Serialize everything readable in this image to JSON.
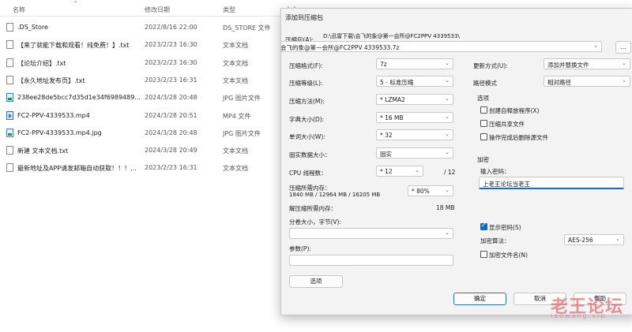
{
  "explorer": {
    "columns": {
      "name": "名称",
      "date": "修改日期",
      "type": "类型",
      "size": "大小"
    },
    "files": [
      {
        "name": ".DS_Store",
        "date": "2022/8/16 22:00",
        "type": "DS_STORE 文件",
        "icon": "file-icon"
      },
      {
        "name": "【来了就能下载和观看！纯免费！】.txt",
        "date": "2023/2/23 16:30",
        "type": "文本文档",
        "icon": "text-file-icon"
      },
      {
        "name": "【论坛介绍】.txt",
        "date": "2023/2/23 16:30",
        "type": "文本文档",
        "icon": "text-file-icon"
      },
      {
        "name": "【永久地址发布页】.txt",
        "date": "2023/2/23 16:31",
        "type": "文本文档",
        "icon": "text-file-icon"
      },
      {
        "name": "238ee28de5bcc7d35d1e34f6989489...",
        "date": "2024/3/28 20:48",
        "type": "JPG 图片文件",
        "icon": "image-file-icon"
      },
      {
        "name": "FC2-PPV-4339533.mp4",
        "date": "2024/3/28 20:51",
        "type": "MP4 文件",
        "icon": "video-file-icon"
      },
      {
        "name": "FC2-PPV-4339533.mp4.jpg",
        "date": "2024/3/28 20:48",
        "type": "JPG 图片文件",
        "icon": "image-file-icon"
      },
      {
        "name": "新建 文本文档.txt",
        "date": "2024/3/28 20:49",
        "type": "文本文档",
        "icon": "text-file-icon"
      },
      {
        "name": "最新地址及APP请发邮箱自动获取！！！...",
        "date": "2023/2/23 16:31",
        "type": "文本文档",
        "icon": "text-file-icon"
      }
    ]
  },
  "dialog": {
    "title": "添加到压缩包",
    "archive_label": "压缩包(A):",
    "archive_dir": "D:\\迅雷下载\\会飞的象@第一会所@FC2PPV 4339533\\",
    "archive_name": "会飞的象@第一会所@FC2PPV 4339533.7z",
    "browse_label": "...",
    "format_label": "压缩格式(F):",
    "format_value": "7z",
    "level_label": "压缩等级(L):",
    "level_value": "5 - 标准压缩",
    "method_label": "压缩方法(M):",
    "method_value": "* LZMA2",
    "dict_label": "字典大小(D):",
    "dict_value": "* 16 MB",
    "word_label": "单词大小(W):",
    "word_value": "* 32",
    "solid_label": "固实数据大小：",
    "solid_value": "固实",
    "cpu_label": "CPU 线程数：",
    "cpu_value": "* 12",
    "cpu_total": "/ 12",
    "mem_comp_label": "压缩所需内存：",
    "mem_comp_detail": "1840 MB / 12964 MB / 16205 MB",
    "mem_comp_value": "* 80%",
    "mem_decomp_label": "解压缩所需内存：",
    "mem_decomp_value": "18 MB",
    "split_label": "分卷大小，字节(V):",
    "split_value": "",
    "params_label": "参数(P):",
    "params_value": "",
    "options_button": "选项",
    "update_label": "更新方式(U):",
    "update_value": "添加并替换文件",
    "path_label": "路径模式",
    "path_value": "相对路径",
    "options_group": "选项",
    "opt_sfx": "创建自释放程序(X)",
    "opt_shared": "压缩共享文件",
    "opt_delete": "操作完成后删除源文件",
    "encrypt_group": "加密",
    "password_label": "输入密码：",
    "password_value": "上老王论坛当老王",
    "show_password": "显示密码(S)",
    "enc_method_label": "加密算法：",
    "enc_method_value": "AES-256",
    "encrypt_names": "加密文件名(N)",
    "ok_button": "确定",
    "cancel_button": "取消",
    "help_button": "帮助"
  },
  "watermark": {
    "text": "老王论坛",
    "sub": "laowang.vip"
  },
  "colors": {
    "accent": "#1767c8",
    "watermark": "#dc3c46"
  }
}
